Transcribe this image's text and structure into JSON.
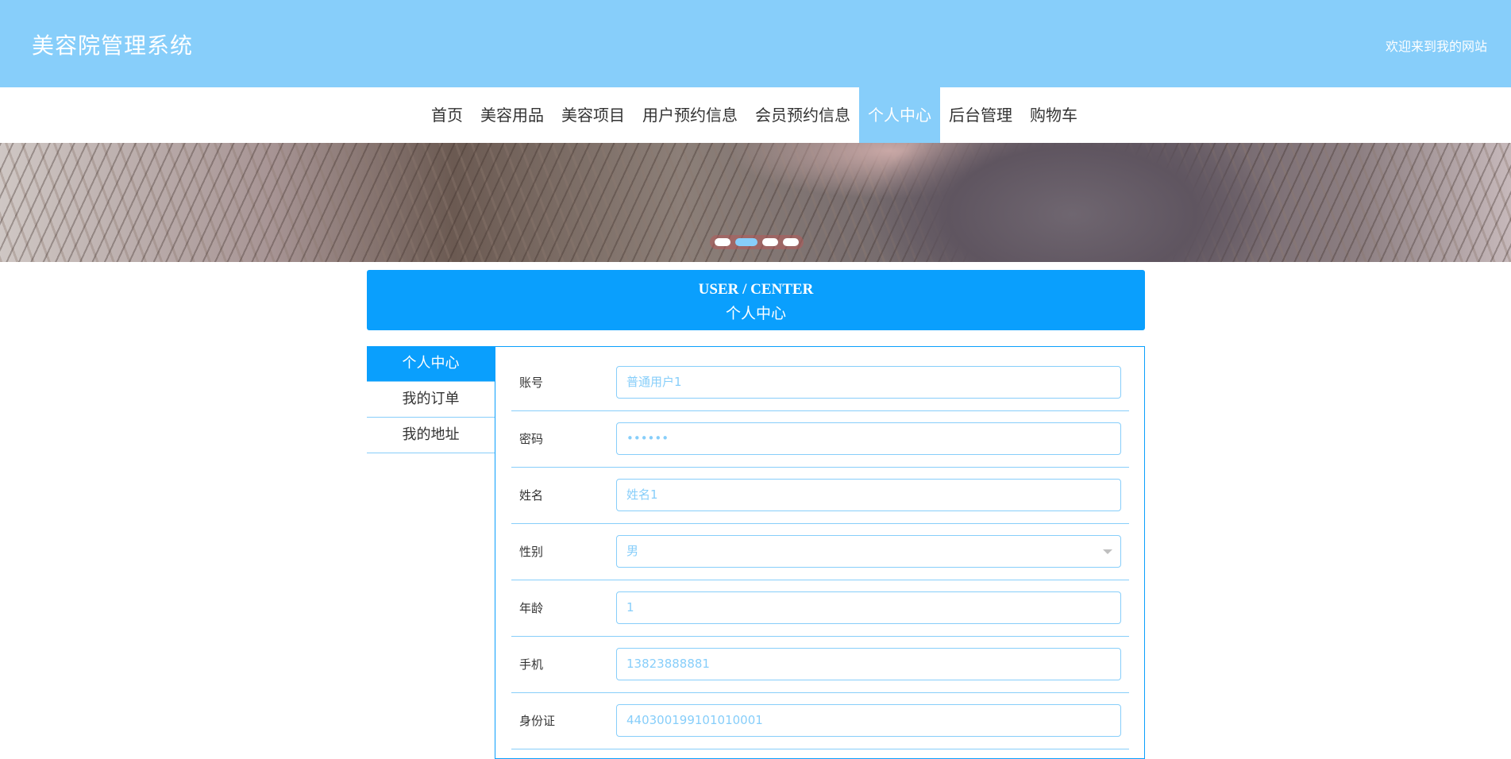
{
  "header": {
    "brand": "美容院管理系统",
    "welcome": "欢迎来到我的网站"
  },
  "nav": {
    "items": [
      {
        "label": "首页"
      },
      {
        "label": "美容用品"
      },
      {
        "label": "美容项目"
      },
      {
        "label": "用户预约信息"
      },
      {
        "label": "会员预约信息"
      },
      {
        "label": "个人中心",
        "active": true
      },
      {
        "label": "后台管理"
      },
      {
        "label": "购物车"
      }
    ]
  },
  "carousel": {
    "slide_count": 4,
    "active_index": 1
  },
  "section": {
    "title_en": "USER / CENTER",
    "title_cn": "个人中心"
  },
  "sidebar": {
    "items": [
      {
        "label": "个人中心",
        "active": true
      },
      {
        "label": "我的订单"
      },
      {
        "label": "我的地址"
      }
    ]
  },
  "form": {
    "account": {
      "label": "账号",
      "value": "普通用户1"
    },
    "password": {
      "label": "密码",
      "value": "••••••"
    },
    "name": {
      "label": "姓名",
      "value": "姓名1"
    },
    "gender": {
      "label": "性别",
      "value": "男"
    },
    "age": {
      "label": "年龄",
      "value": "1"
    },
    "phone": {
      "label": "手机",
      "value": "13823888881"
    },
    "id_card": {
      "label": "身份证",
      "value": "440300199101010001"
    }
  },
  "colors": {
    "header_bg": "#87cefa",
    "accent": "#0a9ffd",
    "field_text": "#87cefa"
  }
}
